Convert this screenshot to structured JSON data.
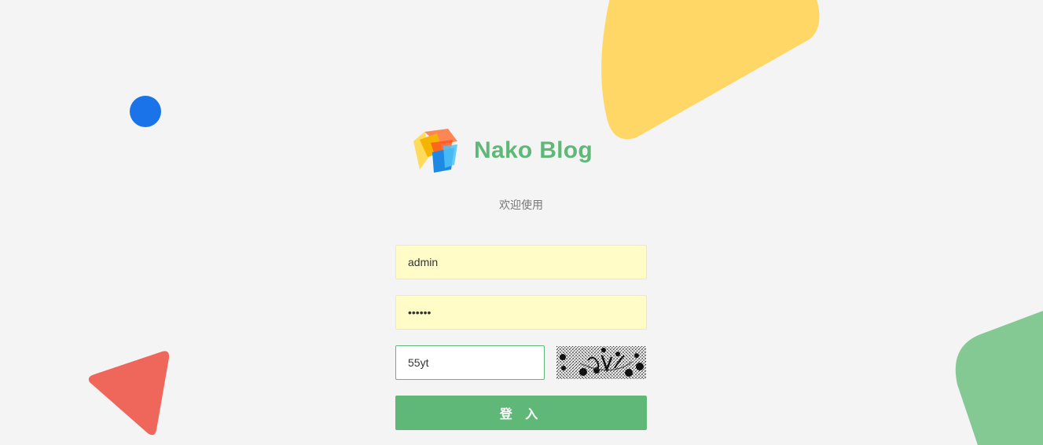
{
  "brand": {
    "name": "Nako Blog",
    "subtitle": "欢迎使用",
    "accent_color": "#5fb878"
  },
  "form": {
    "username": {
      "value": "admin",
      "placeholder": ""
    },
    "password": {
      "value": "nako12",
      "placeholder": ""
    },
    "captcha": {
      "value": "55yt",
      "placeholder": ""
    },
    "submit_label": "登 入"
  },
  "decorations": {
    "circle_color": "#1a73e8",
    "semicircle_color": "#ffd766",
    "triangle_color": "#ef665b",
    "rounded_shape_color": "#84c993"
  }
}
